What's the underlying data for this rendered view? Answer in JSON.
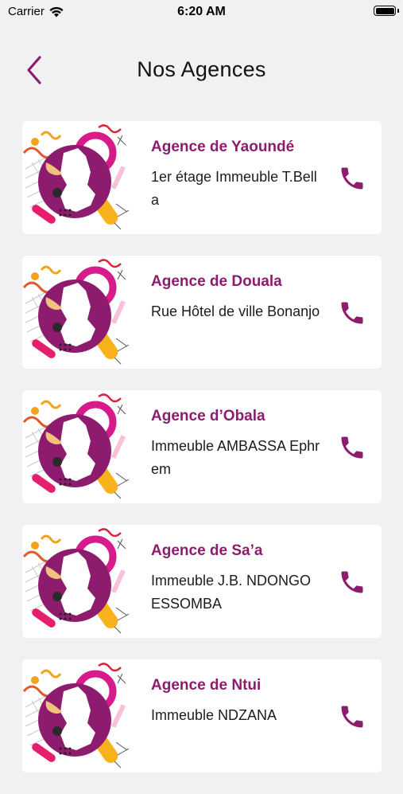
{
  "status_bar": {
    "carrier": "Carrier",
    "time": "6:20 AM"
  },
  "nav": {
    "title": "Nos Agences"
  },
  "colors": {
    "accent": "#8e1c6e",
    "background": "#f1f1f3"
  },
  "agencies": [
    {
      "name": "Agence de Yaoundé",
      "address": "1er étage Immeuble T.Bella"
    },
    {
      "name": "Agence de Douala",
      "address": "Rue Hôtel de ville Bonanjo"
    },
    {
      "name": "Agence d’Obala",
      "address": "Immeuble AMBASSA Ephrem"
    },
    {
      "name": "Agence de Sa’a",
      "address": "Immeuble J.B. NDONGO ESSOMBA"
    },
    {
      "name": "Agence de Ntui",
      "address": "Immeuble NDZANA"
    }
  ]
}
